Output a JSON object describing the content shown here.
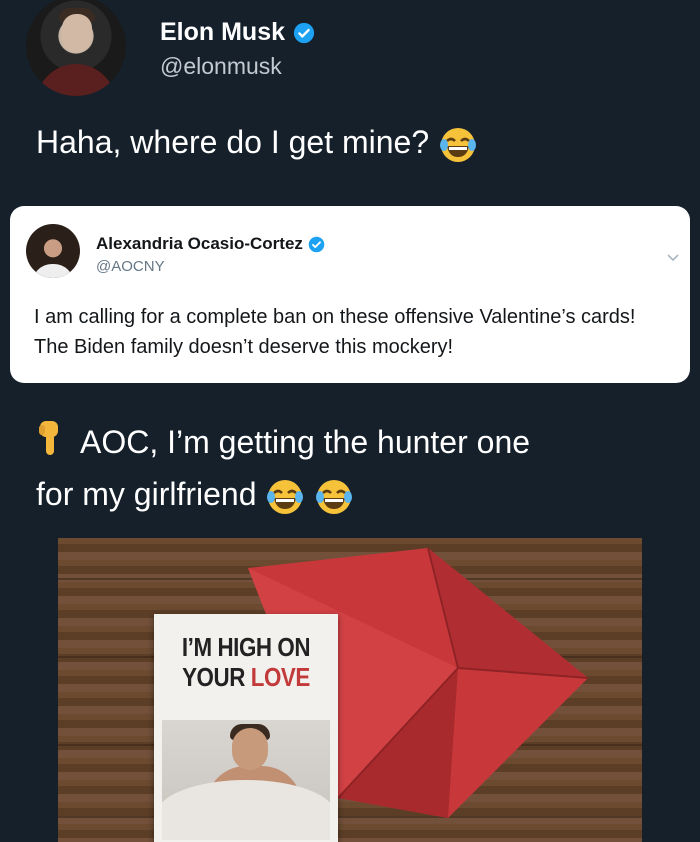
{
  "author": {
    "display_name": "Elon Musk",
    "handle": "@elonmusk",
    "verified": true
  },
  "tweet": {
    "text": "Haha, where do I get mine?",
    "emoji": "face-with-tears-of-joy"
  },
  "quoted_tweet": {
    "display_name": "Alexandria Ocasio-Cortez",
    "handle": "@AOCNY",
    "verified": true,
    "text_line1": "I am calling for a complete ban on these offensive Valentine’s cards!",
    "text_line2": "The Biden family doesn’t deserve this mockery!"
  },
  "reply": {
    "line1": "AOC, I’m getting the hunter one",
    "line2": "for my girlfriend",
    "emoji_count": 2
  },
  "card": {
    "line1": "I’M HIGH ON",
    "line2_prefix": "YOUR ",
    "line2_highlight": "LOVE"
  },
  "colors": {
    "background": "#15202b",
    "verified_blue": "#1da1f2",
    "envelope_red": "#c8383a",
    "love_red": "#c23a3a"
  }
}
